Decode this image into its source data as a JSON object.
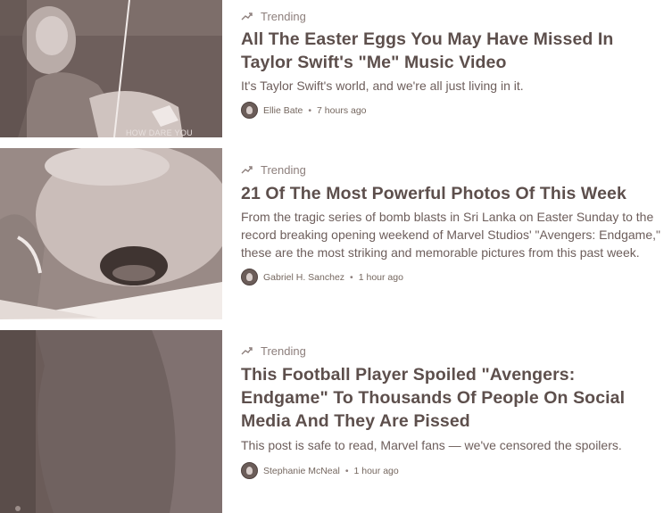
{
  "colors": {
    "text": "#5d4f4c",
    "muted": "#8d7f7c",
    "thumb": "#6e5f5c"
  },
  "stories": [
    {
      "trend_icon": "trending-arrow-icon",
      "trend_label": "Trending",
      "title": "All The Easter Eggs You May Have Missed In Taylor Swift's \"Me\" Music Video",
      "description": "It's Taylor Swift's world, and we're all just living in it.",
      "author": "Ellie Bate",
      "separator": "•",
      "time": "7 hours ago",
      "image_caption": "HOW DARE YOU"
    },
    {
      "trend_icon": "trending-arrow-icon",
      "trend_label": "Trending",
      "title": "21 Of The Most Powerful Photos Of This Week",
      "description": "From the tragic series of bomb blasts in Sri Lanka on Easter Sunday to the record breaking opening weekend of Marvel Studios' \"Avengers: Endgame,\" these are the most striking and memorable pictures from this past week.",
      "author": "Gabriel H. Sanchez",
      "separator": "•",
      "time": "1 hour ago"
    },
    {
      "trend_icon": "trending-arrow-icon",
      "trend_label": "Trending",
      "title": "This Football Player Spoiled \"Avengers: Endgame\" To Thousands Of People On Social Media And They Are Pissed",
      "description": "This post is safe to read, Marvel fans — we've censored the spoilers.",
      "author": "Stephanie McNeal",
      "separator": "•",
      "time": "1 hour ago"
    }
  ]
}
